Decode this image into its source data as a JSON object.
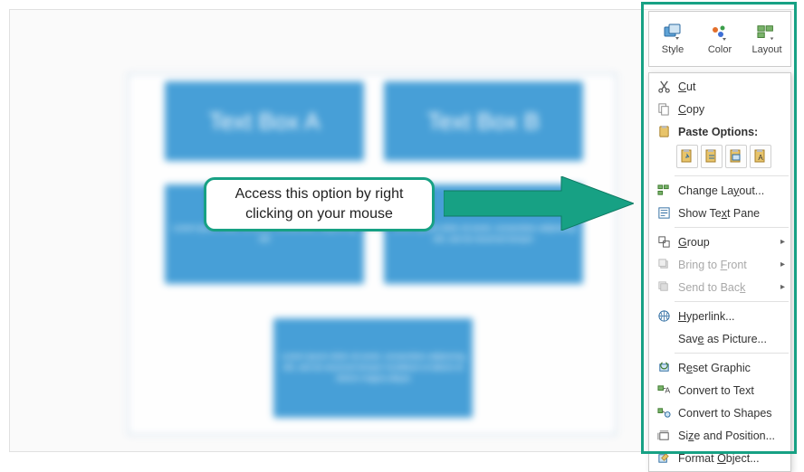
{
  "canvas": {
    "boxA": "Text Box A",
    "boxB": "Text Box B",
    "boxC": "Lorem ipsum dolor sit amet, consectetur adipiscing elit",
    "boxD": "Lorem ipsum dolor sit amet, consectetur adipiscing elit, sed do eiusmod tempor",
    "boxE": "Lorem ipsum dolor sit amet, consectetur adipiscing elit, sed do eiusmod tempor incididunt ut labore et dolore magna aliqua"
  },
  "callout": {
    "text": "Access this option by right clicking on your mouse"
  },
  "mini_toolbar": {
    "style": "Style",
    "color": "Color",
    "layout": "Layout"
  },
  "context_menu": {
    "cut": "Cut",
    "copy": "Copy",
    "paste_options": "Paste Options:",
    "change_layout": "Change Layout...",
    "show_text_pane": "Show Text Pane",
    "group": "Group",
    "bring_to_front": "Bring to Front",
    "send_to_back": "Send to Back",
    "hyperlink": "Hyperlink...",
    "save_as_picture": "Save as Picture...",
    "reset_graphic": "Reset Graphic",
    "convert_to_text": "Convert to Text",
    "convert_to_shapes": "Convert to Shapes",
    "size_and_position": "Size and Position...",
    "format_object": "Format Object..."
  },
  "colors": {
    "accent": "#17a184",
    "box": "#3e9bd6"
  }
}
